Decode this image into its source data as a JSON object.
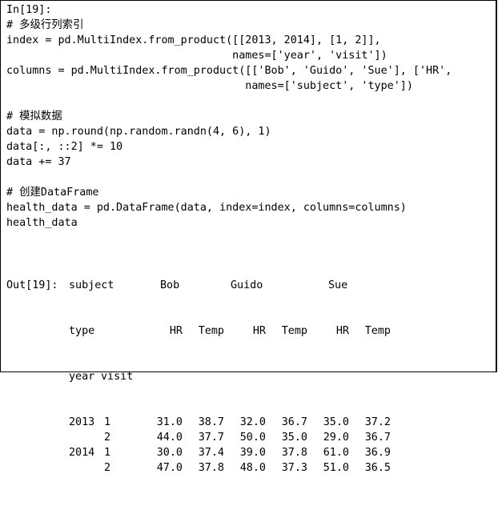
{
  "cell": {
    "in_prompt": "In[19]:",
    "lines": [
      "# 多级行列索引",
      "index = pd.MultiIndex.from_product([[2013, 2014], [1, 2]],",
      "                                   names=['year', 'visit'])",
      "columns = pd.MultiIndex.from_product([['Bob', 'Guido', 'Sue'], ['HR',",
      "                                     names=['subject', 'type'])",
      "",
      "# 模拟数据",
      "data = np.round(np.random.randn(4, 6), 1)",
      "data[:, ::2] *= 10",
      "data += 37",
      "",
      "# 创建DataFrame",
      "health_data = pd.DataFrame(data, index=index, columns=columns)",
      "health_data"
    ]
  },
  "output": {
    "out_prompt": "Out[19]:",
    "header": {
      "level0_name": "subject",
      "level1_name": "type",
      "subjects": [
        "Bob",
        "Guido",
        "Sue"
      ],
      "types": [
        "HR",
        "Temp",
        "HR",
        "Temp",
        "HR",
        "Temp"
      ],
      "index_names": [
        "year",
        "visit"
      ]
    },
    "rows": [
      {
        "year": "2013",
        "visit": "1",
        "values": [
          "31.0",
          "38.7",
          "32.0",
          "36.7",
          "35.0",
          "37.2"
        ]
      },
      {
        "year": "",
        "visit": "2",
        "values": [
          "44.0",
          "37.7",
          "50.0",
          "35.0",
          "29.0",
          "36.7"
        ]
      },
      {
        "year": "2014",
        "visit": "1",
        "values": [
          "30.0",
          "37.4",
          "39.0",
          "37.8",
          "61.0",
          "36.9"
        ]
      },
      {
        "year": "",
        "visit": "2",
        "values": [
          "47.0",
          "37.8",
          "48.0",
          "37.3",
          "51.0",
          "36.5"
        ]
      }
    ]
  }
}
